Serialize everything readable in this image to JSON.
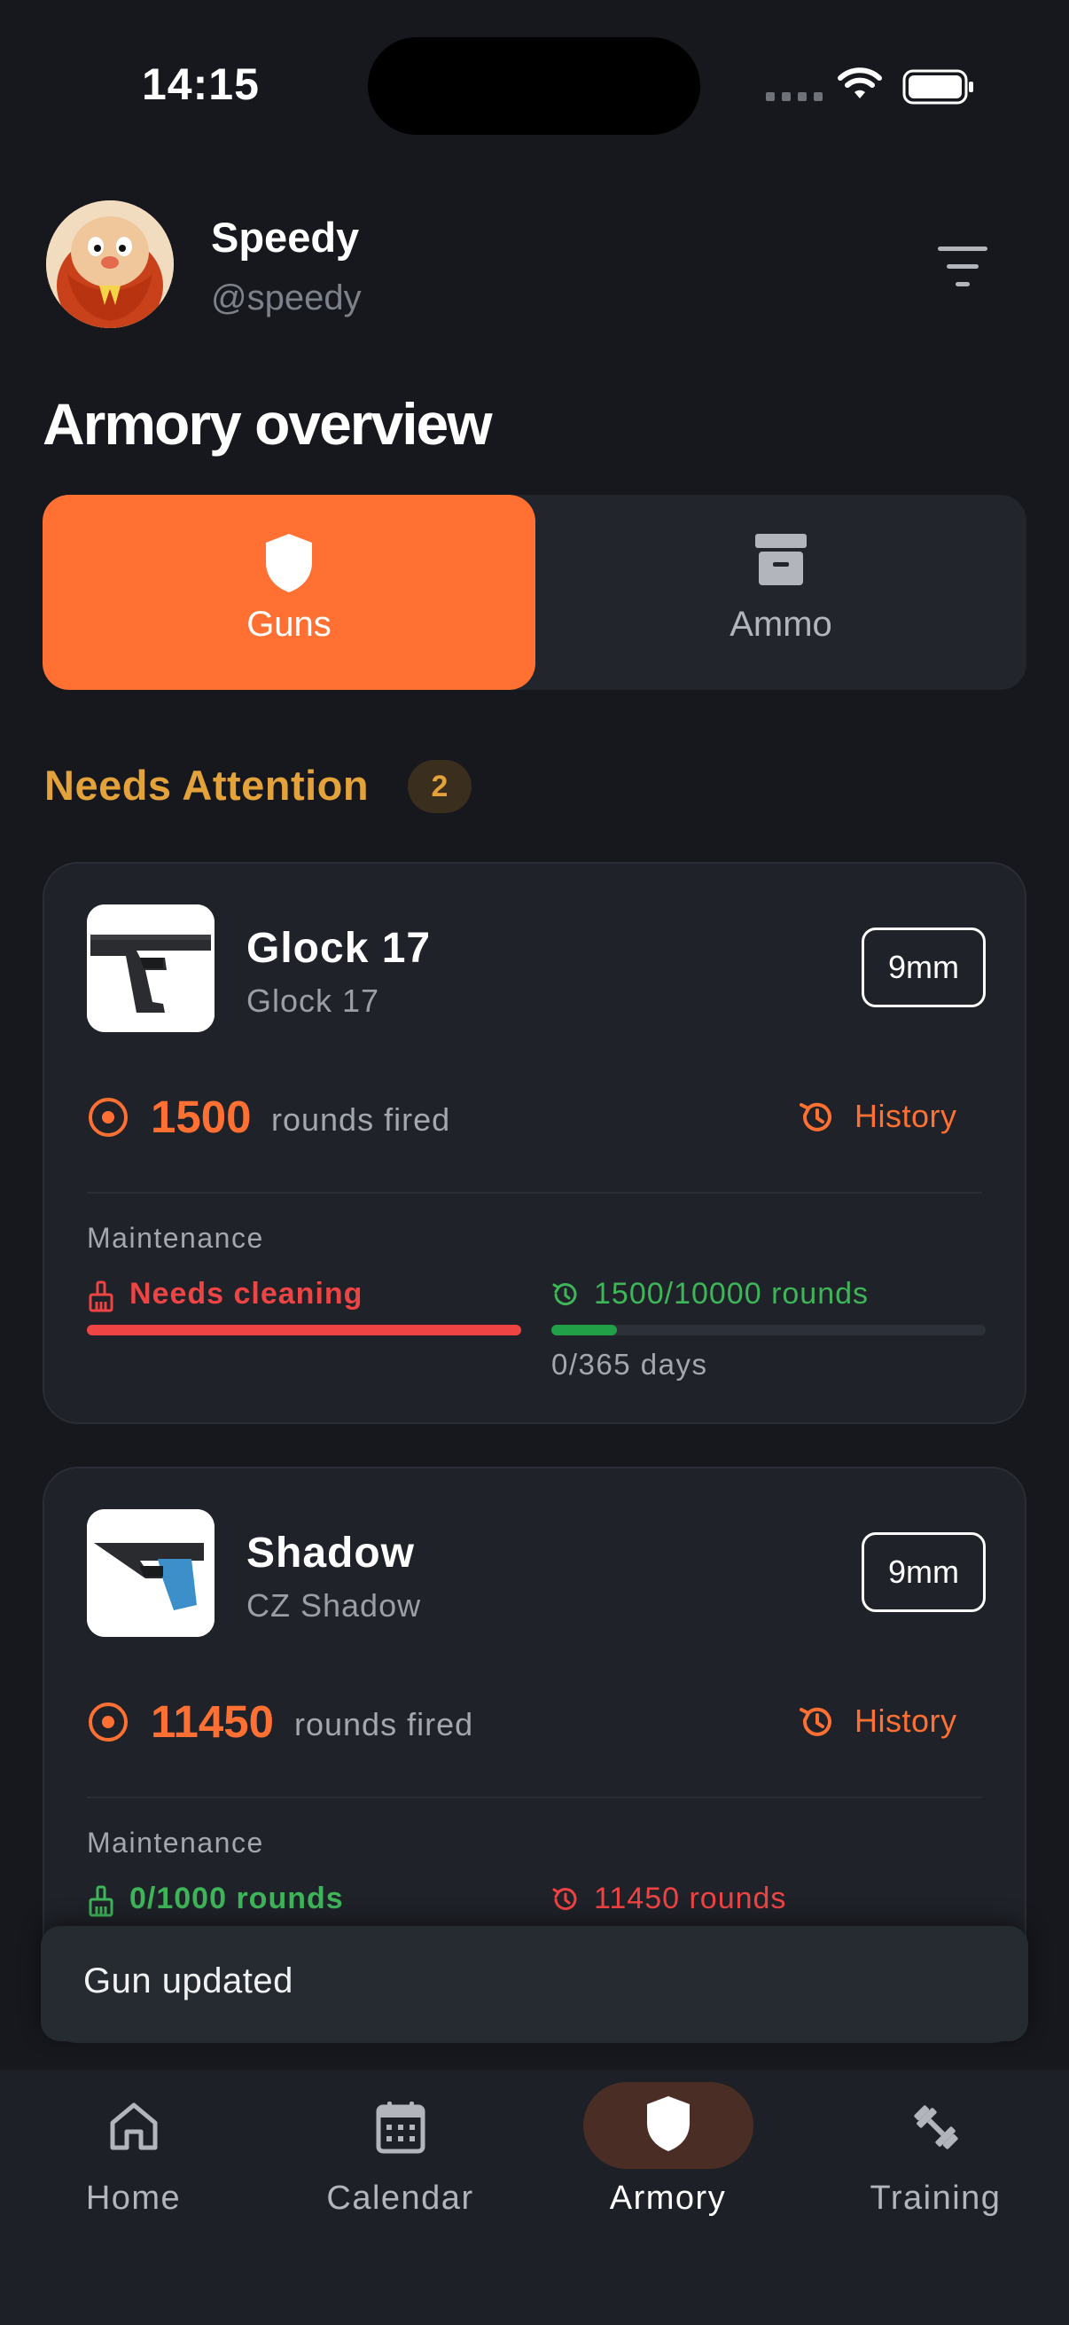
{
  "status_bar": {
    "time": "14:15"
  },
  "profile": {
    "name": "Speedy",
    "handle": "@speedy"
  },
  "page_title": "Armory overview",
  "tabs": [
    {
      "label": "Guns",
      "icon": "shield-icon",
      "selected": true
    },
    {
      "label": "Ammo",
      "icon": "archive-box-icon",
      "selected": false
    }
  ],
  "section": {
    "title": "Needs Attention",
    "count": "2"
  },
  "guns": [
    {
      "name": "Glock 17",
      "model": "Glock 17",
      "caliber": "9mm",
      "rounds": "1500",
      "rounds_label": "rounds fired",
      "history_label": "History",
      "maintenance_label": "Maintenance",
      "cleaning_status": "Needs cleaning",
      "service_status": "1500/10000 rounds",
      "service_progress": 0.15,
      "days_status": "0/365 days"
    },
    {
      "name": "Shadow",
      "model": "CZ Shadow",
      "caliber": "9mm",
      "rounds": "11450",
      "rounds_label": "rounds fired",
      "history_label": "History",
      "maintenance_label": "Maintenance",
      "cleaning_status": "0/1000 rounds",
      "service_status": "11450 rounds"
    }
  ],
  "toast": {
    "message": "Gun updated"
  },
  "bottom_nav": [
    {
      "label": "Home",
      "icon": "home-icon"
    },
    {
      "label": "Calendar",
      "icon": "calendar-icon"
    },
    {
      "label": "Armory",
      "icon": "shield-icon",
      "active": true
    },
    {
      "label": "Training",
      "icon": "dumbbell-icon"
    }
  ],
  "colors": {
    "accent": "#ff7032",
    "warning": "#e3a23a",
    "danger": "#ef4444",
    "success": "#3fb55a",
    "background": "#16181d"
  }
}
